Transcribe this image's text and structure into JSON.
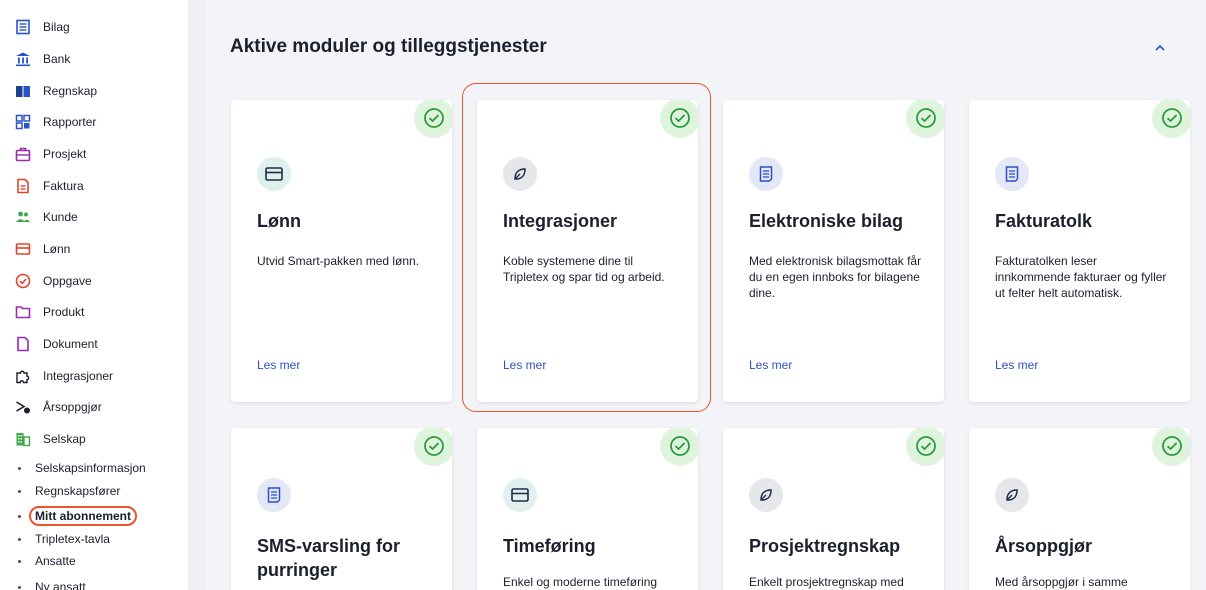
{
  "sidebar": {
    "items": [
      {
        "label": "Bilag",
        "icon": "document-list-icon"
      },
      {
        "label": "Bank",
        "icon": "bank-icon"
      },
      {
        "label": "Regnskap",
        "icon": "book-icon"
      },
      {
        "label": "Rapporter",
        "icon": "grid-icon"
      },
      {
        "label": "Prosjekt",
        "icon": "briefcase-icon"
      },
      {
        "label": "Faktura",
        "icon": "invoice-icon"
      },
      {
        "label": "Kunde",
        "icon": "people-icon"
      },
      {
        "label": "Lønn",
        "icon": "card-icon"
      },
      {
        "label": "Oppgave",
        "icon": "check-circle-icon"
      },
      {
        "label": "Produkt",
        "icon": "folder-icon"
      },
      {
        "label": "Dokument",
        "icon": "file-icon"
      },
      {
        "label": "Integrasjoner",
        "icon": "puzzle-icon"
      },
      {
        "label": "Årsoppgjør",
        "icon": "year-end-icon"
      },
      {
        "label": "Selskap",
        "icon": "building-icon"
      }
    ],
    "sub_items": [
      {
        "label": "Selskapsinformasjon"
      },
      {
        "label": "Regnskapsfører"
      },
      {
        "label": "Mitt abonnement",
        "active": true
      },
      {
        "label": "Tripletex-tavla"
      },
      {
        "label": "Ansatte"
      },
      {
        "label": "Ny ansatt"
      }
    ]
  },
  "main": {
    "title": "Aktive moduler og tilleggstjenester",
    "collapse_icon": "chevron-up-icon",
    "cards": [
      {
        "name": "Lønn",
        "desc": "Utvid Smart-pakken med lønn.",
        "more": "Les mer",
        "icon": "card-icon"
      },
      {
        "name": "Integrasjoner",
        "desc": "Koble systemene dine til Tripletex og spar tid og arbeid.",
        "more": "Les mer",
        "icon": "leaf-icon"
      },
      {
        "name": "Elektroniske bilag",
        "desc": "Med elektronisk bilagsmottak får du en egen innboks for bilagene dine.",
        "more": "Les mer",
        "icon": "receipt-icon"
      },
      {
        "name": "Fakturatolk",
        "desc": "Fakturatolken leser innkommende fakturaer og fyller ut felter helt automatisk.",
        "more": "Les mer",
        "icon": "receipt-icon"
      },
      {
        "name": "SMS-varsling for purringer",
        "desc": "",
        "more": "",
        "icon": "receipt-icon"
      },
      {
        "name": "Timeføring",
        "desc": "Enkel og moderne timeføring",
        "more": "",
        "icon": "card-icon"
      },
      {
        "name": "Prosjektregnskap",
        "desc": "Enkelt prosjektregnskap med",
        "more": "",
        "icon": "leaf-icon"
      },
      {
        "name": "Årsoppgjør",
        "desc": "Med årsoppgjør i samme",
        "more": "",
        "icon": "leaf-icon"
      }
    ]
  },
  "colors": {
    "accent": "#2c52c7",
    "highlight": "#e8552b",
    "check_bg": "#def4dd",
    "check_fg": "#2f9a3f"
  }
}
